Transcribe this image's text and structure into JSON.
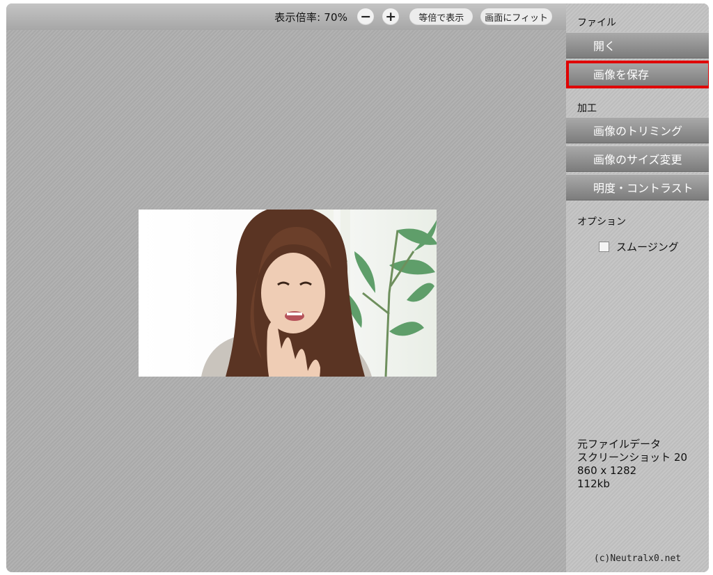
{
  "toolbar": {
    "zoom_label": "表示倍率: 70%",
    "zoom_out_label": "−",
    "zoom_in_label": "+",
    "actual_size_label": "等倍で表示",
    "fit_screen_label": "画面にフィット"
  },
  "sidebar": {
    "file_section": "ファイル",
    "open_label": "開く",
    "save_label": "画像を保存",
    "edit_section": "加工",
    "trim_label": "画像のトリミング",
    "resize_label": "画像のサイズ変更",
    "brightness_label": "明度・コントラスト",
    "options_section": "オプション",
    "smoothing_label": "スムージング",
    "smoothing_checked": false
  },
  "file_info": {
    "heading": "元ファイルデータ",
    "name": "スクリーンショット 20",
    "dimensions": "860 x 1282",
    "size": "112kb"
  },
  "footer": {
    "copyright": "(c)Neutralx0.net"
  },
  "colors": {
    "highlight": "#e00000",
    "button_top": "#a9a9a9",
    "button_bottom": "#7c7c7c"
  }
}
